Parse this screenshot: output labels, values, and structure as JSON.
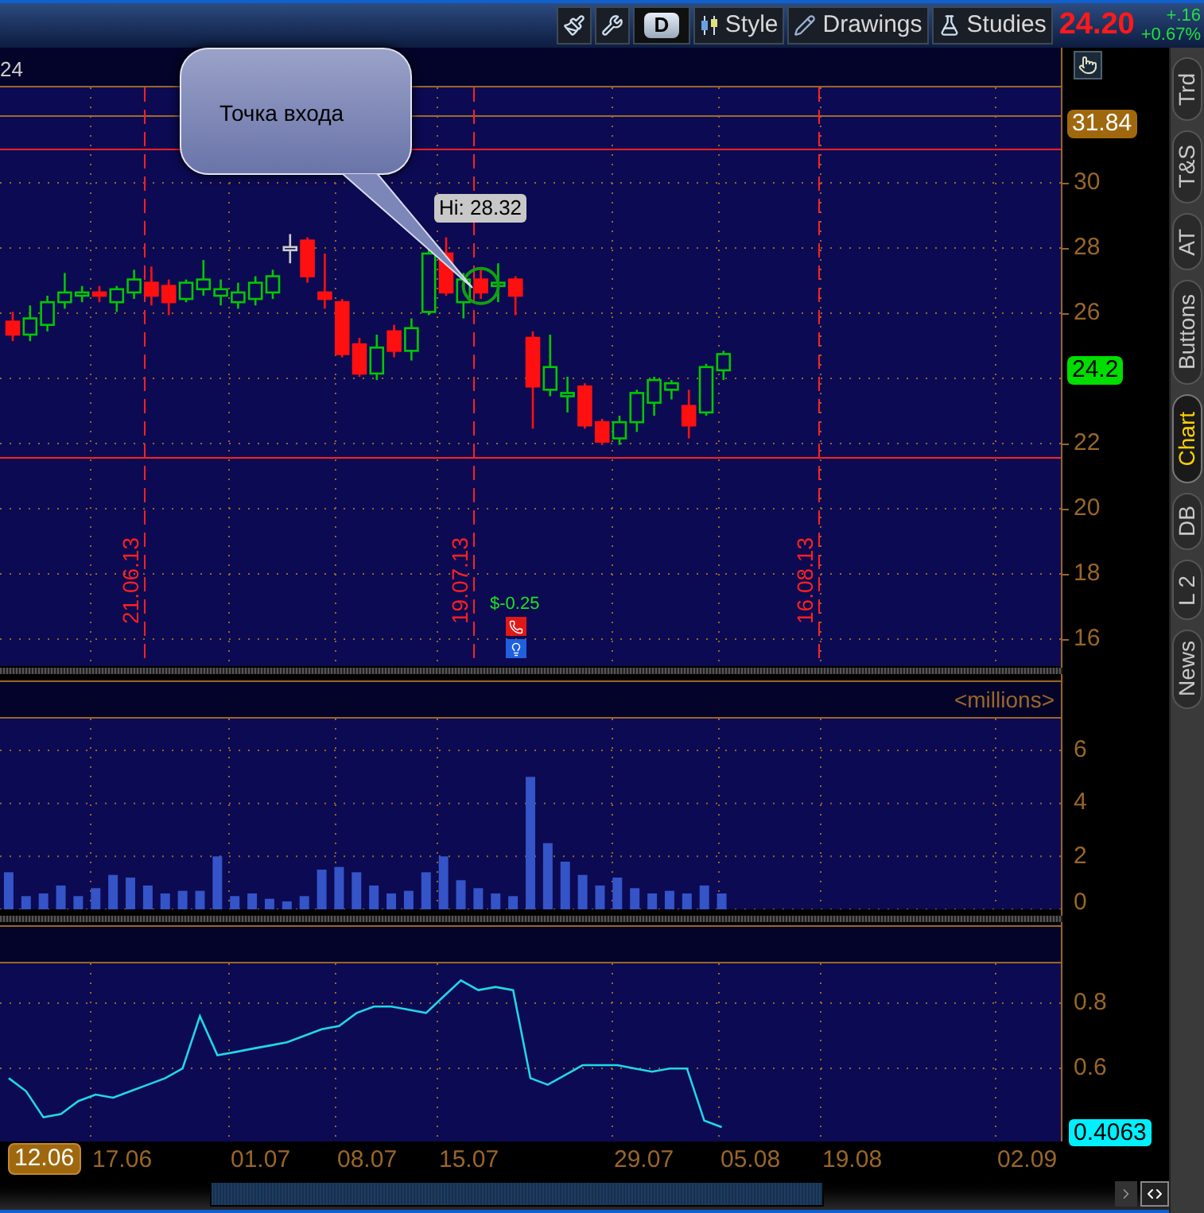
{
  "toolbar": {
    "buttons": [
      {
        "kind": "paint"
      },
      {
        "kind": "wrench"
      },
      {
        "kind": "aggregation",
        "label": "D"
      },
      {
        "kind": "style",
        "label": "Style"
      },
      {
        "kind": "drawings",
        "label": "Drawings"
      },
      {
        "kind": "studies",
        "label": "Studies"
      }
    ],
    "last_price": "24.20",
    "change": "+.16",
    "change_percent": "+0.67%"
  },
  "side_tabs": [
    {
      "label": "Trd",
      "selected": false
    },
    {
      "label": "T&S",
      "selected": false
    },
    {
      "label": "AT",
      "selected": false
    },
    {
      "label": "Buttons",
      "selected": false
    },
    {
      "label": "Chart",
      "selected": true
    },
    {
      "label": "DB",
      "selected": false
    },
    {
      "label": "L 2",
      "selected": false
    },
    {
      "label": "News",
      "selected": false
    }
  ],
  "price_panel": {
    "header": "24",
    "callout": "Точка входа",
    "high_label": "Hi: 28.32",
    "event_lines": [
      "21.06.13",
      "19.07.13",
      "16.08.13"
    ],
    "event_amount": "$-0.25",
    "price_axis": [
      "30",
      "28",
      "26",
      "22",
      "20",
      "18",
      "16"
    ],
    "markers": [
      {
        "label": "31.84",
        "color": "#a0680e"
      },
      {
        "label": "24.2",
        "color": "#00dd00"
      }
    ]
  },
  "volume_panel": {
    "unit_label": "<millions>",
    "chart_data": {
      "type": "bar",
      "yticks": [
        0,
        2,
        4,
        6
      ],
      "ylim": [
        0,
        7.2
      ],
      "grid": true,
      "values": [
        1.4,
        0.5,
        0.6,
        0.9,
        0.5,
        0.8,
        1.3,
        1.2,
        0.9,
        0.6,
        0.7,
        0.7,
        2.0,
        0.5,
        0.6,
        0.4,
        0.3,
        0.5,
        1.5,
        1.6,
        1.4,
        0.9,
        0.6,
        0.7,
        1.4,
        2.0,
        1.1,
        0.8,
        0.6,
        0.5,
        5.0,
        2.5,
        1.8,
        1.3,
        0.9,
        1.2,
        0.8,
        0.6,
        0.7,
        0.6,
        0.9,
        0.6,
        null,
        null,
        null,
        null,
        null,
        null,
        null,
        null,
        null,
        null,
        null,
        null,
        null,
        null,
        null,
        null,
        null,
        null,
        null
      ]
    }
  },
  "indicator_panel": {
    "value_label": "0.4063",
    "chart_data": {
      "type": "line",
      "yticks": [
        0.6,
        0.8
      ],
      "ylim": [
        0.376,
        0.922
      ],
      "grid": true,
      "series": [
        {
          "color": "#20d8e8",
          "values": [
            0.57,
            0.53,
            0.45,
            0.46,
            0.5,
            0.52,
            0.51,
            0.53,
            0.55,
            0.57,
            0.6,
            0.76,
            0.64,
            0.65,
            0.66,
            0.67,
            0.68,
            0.7,
            0.72,
            0.73,
            0.77,
            0.79,
            0.79,
            0.78,
            0.77,
            0.82,
            0.87,
            0.84,
            0.85,
            0.84,
            0.57,
            0.55,
            0.58,
            0.61,
            0.61,
            0.61,
            0.6,
            0.59,
            0.6,
            0.6,
            0.44,
            0.42,
            null,
            null,
            null,
            null,
            null,
            null,
            null,
            null,
            null,
            null,
            null,
            null,
            null,
            null,
            null,
            null,
            null,
            null,
            null
          ]
        }
      ]
    }
  },
  "date_axis": {
    "current": "12.06",
    "ticks": [
      "17.06",
      "01.07",
      "08.07",
      "15.07",
      "29.07",
      "05.08",
      "19.08",
      "02.09"
    ]
  }
}
